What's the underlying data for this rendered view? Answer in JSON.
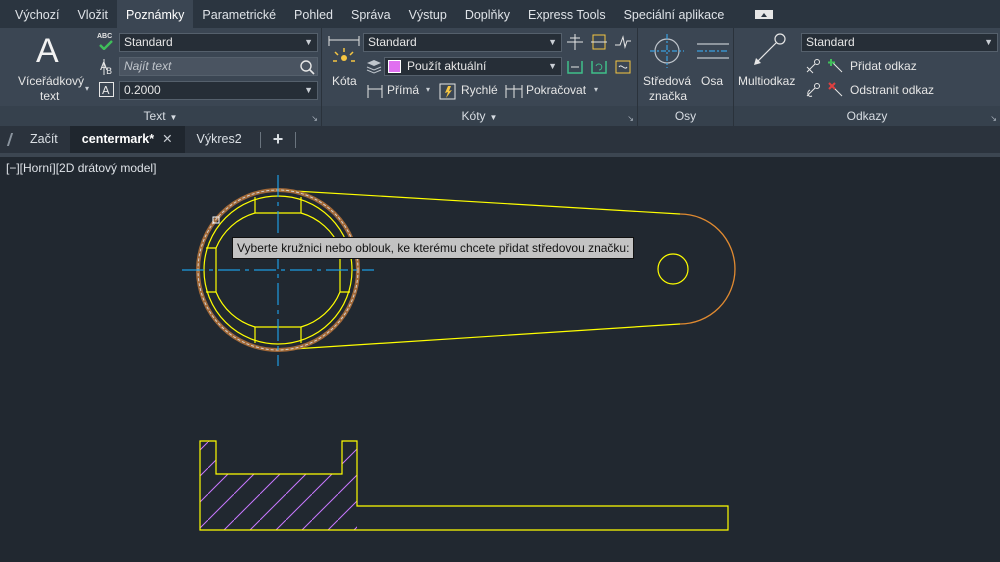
{
  "ribbon_tabs": [
    "Výchozí",
    "Vložit",
    "Poznámky",
    "Parametrické",
    "Pohled",
    "Správa",
    "Výstup",
    "Doplňky",
    "Express Tools",
    "Speciální aplikace"
  ],
  "ribbon_tab_active": "Poznámky",
  "panels": {
    "text": {
      "title": "Text",
      "big_button_line1": "Víceřádkový",
      "big_button_line2": "text",
      "big_icon_glyph": "A",
      "style_combo": "Standard",
      "find_placeholder": "Najít text",
      "height_combo": "0.2000",
      "abc_label": "ABC"
    },
    "dimensions": {
      "title": "Kóty",
      "big_button": "Kóta",
      "style_combo": "Standard",
      "layer_combo": "Použít aktuální",
      "linear_button": "Přímá",
      "quick_button": "Rychlé",
      "continue_button": "Pokračovat"
    },
    "centerlines": {
      "title": "Osy",
      "center_mark_line1": "Středová",
      "center_mark_line2": "značka",
      "centerline_button": "Osa"
    },
    "leaders": {
      "title": "Odkazy",
      "multileader_button": "Multiodkaz",
      "style_combo": "Standard",
      "add_leader": "Přidat odkaz",
      "remove_leader": "Odstranit odkaz"
    }
  },
  "file_tabs": {
    "start": "Začít",
    "active": "centermark*",
    "other": "Výkres2",
    "close_glyph": "✕",
    "new_glyph": "+"
  },
  "viewport_label": "[−][Horní][2D drátový model]",
  "tooltip": "Vyberte kružnici nebo oblouk, ke kterému chcete přidat středovou značku:",
  "colors": {
    "background": "#212830",
    "geometry": "#ffff00",
    "centerline": "#1e9be0",
    "hatch": "#c878ff",
    "highlight": "#c87a2a",
    "layer_swatch": "#e070f0"
  }
}
